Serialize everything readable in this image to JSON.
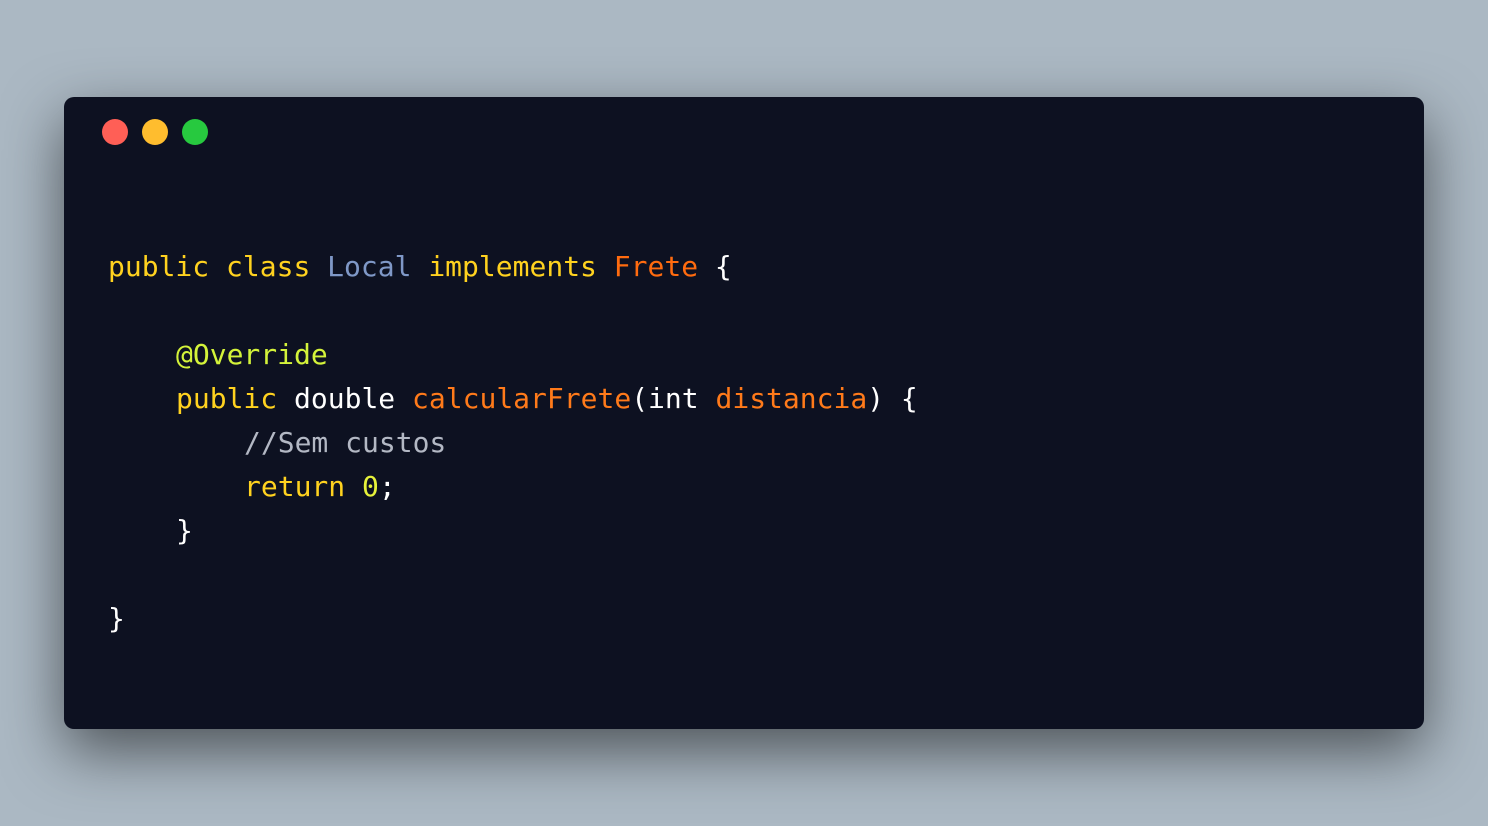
{
  "colors": {
    "background": "#abb8c3",
    "window": "#0d1121",
    "red_dot": "#ff5f56",
    "yellow_dot": "#ffbd2e",
    "green_dot": "#27c93f"
  },
  "window_controls": [
    "close-icon",
    "minimize-icon",
    "maximize-icon"
  ],
  "code": {
    "line1": {
      "kw_public": "public",
      "kw_class": "class",
      "class_name": "Local",
      "kw_implements": "implements",
      "interface_name": "Frete",
      "brace_open": "{"
    },
    "line3": {
      "annotation": "@Override"
    },
    "line4": {
      "kw_public": "public",
      "type": "double",
      "method_name": "calcularFrete",
      "paren_open": "(",
      "param_type": "int",
      "param_name": "distancia",
      "paren_close": ")",
      "brace_open": "{"
    },
    "line5": {
      "comment": "//Sem custos"
    },
    "line6": {
      "kw_return": "return",
      "value": "0",
      "semicolon": ";"
    },
    "line7": {
      "brace_close": "}"
    },
    "line9": {
      "brace_close": "}"
    }
  }
}
